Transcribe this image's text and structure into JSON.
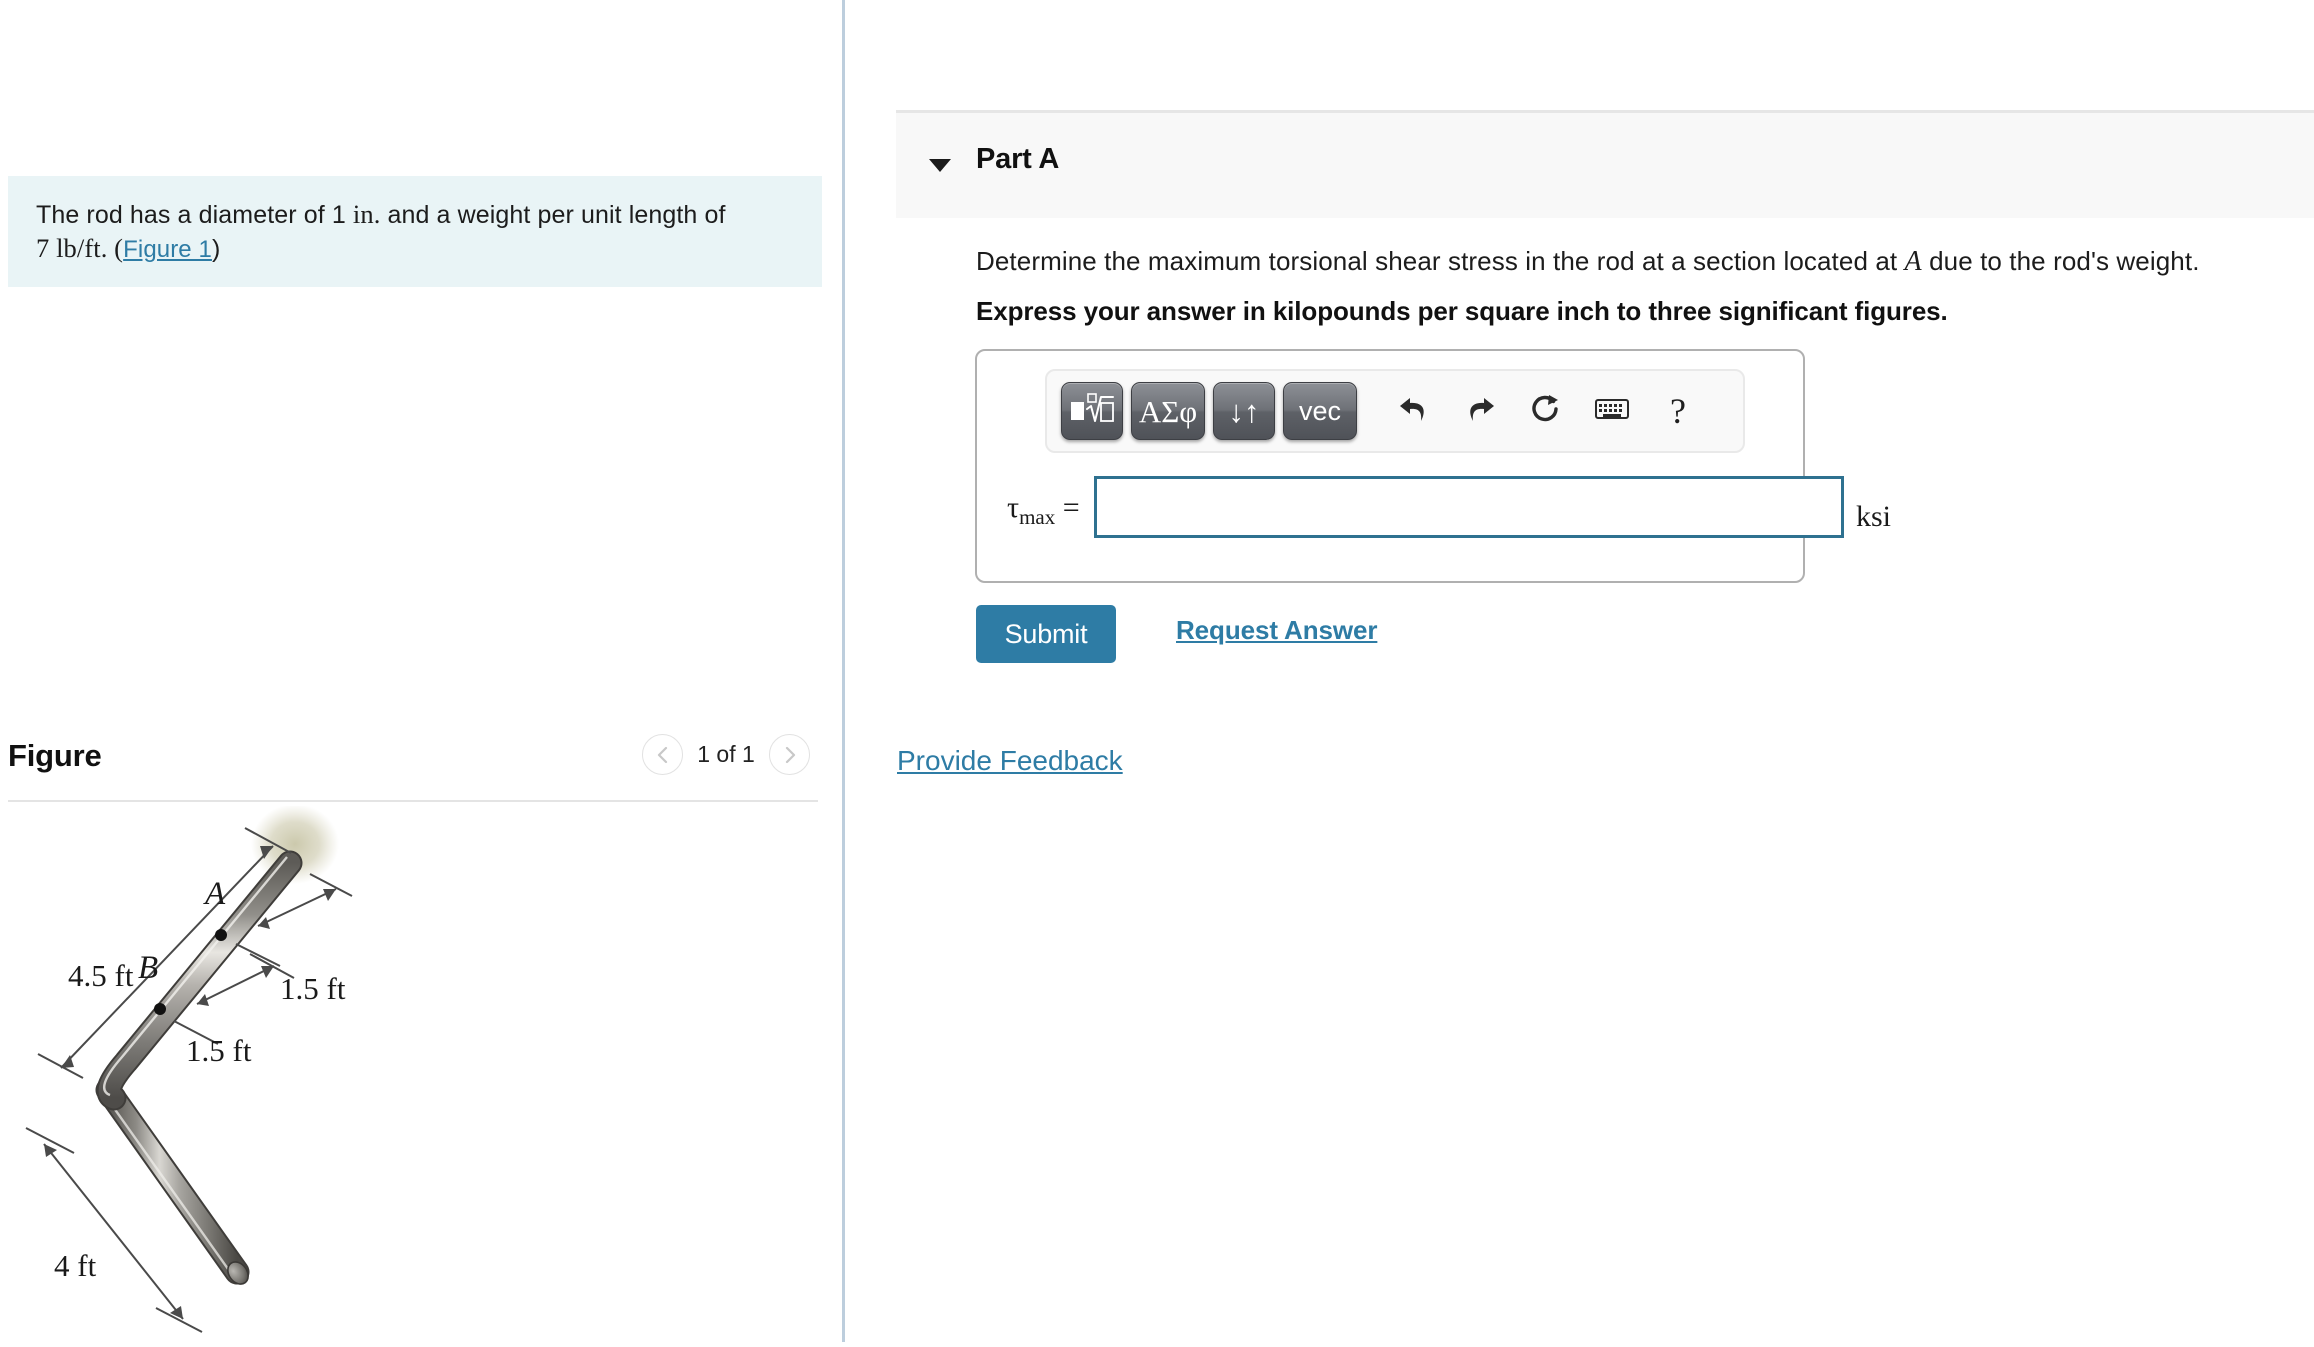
{
  "left_panel": {
    "problem_statement": {
      "line1_pre": "The rod has a diameter of 1 ",
      "line1_unit": "in.",
      "line1_post": " and a weight per unit length of",
      "line2_value": "7 lb/ft. (",
      "figure_link": "Figure 1",
      "line2_close": ")"
    },
    "figure_section": {
      "title": "Figure",
      "page_indicator": "1 of 1",
      "prev_icon": "chevron-left-icon",
      "next_icon": "chevron-right-icon"
    },
    "figure_diagram": {
      "type": "engineering-diagram",
      "description": "L-shaped circular rod fixed at a wall, shown in isometric view",
      "labels": [
        {
          "text": "4.5 ft",
          "kind": "dimension"
        },
        {
          "text": "1.5 ft",
          "kind": "dimension"
        },
        {
          "text": "1.5 ft",
          "kind": "dimension"
        },
        {
          "text": "4 ft",
          "kind": "dimension"
        },
        {
          "text": "A",
          "kind": "point"
        },
        {
          "text": "B",
          "kind": "point"
        }
      ]
    }
  },
  "right_panel": {
    "part_header": {
      "label": "Part A",
      "caret_icon": "triangle-down-icon"
    },
    "question_pre": "Determine the maximum torsional shear stress in the rod at a section located at ",
    "question_var": "A",
    "question_post": " due to the rod's weight.",
    "instruction": "Express your answer in kilopounds per square inch to three significant figures.",
    "math_toolbar": {
      "buttons": [
        {
          "name": "math-template-button",
          "glyph": "template-radical-icon"
        },
        {
          "name": "greek-symbols-button",
          "glyph": "ΑΣφ"
        },
        {
          "name": "arrows-button",
          "glyph": "↓↑"
        },
        {
          "name": "vector-button",
          "glyph": "vec"
        }
      ],
      "icons": [
        {
          "name": "undo-icon"
        },
        {
          "name": "redo-icon"
        },
        {
          "name": "reset-icon"
        },
        {
          "name": "keyboard-icon"
        },
        {
          "name": "help-icon",
          "glyph": "?"
        }
      ]
    },
    "answer": {
      "variable": "τ",
      "subscript": "max",
      "equals": "=",
      "value": "",
      "placeholder": "",
      "unit": "ksi"
    },
    "submit_label": "Submit",
    "request_answer_label": "Request Answer",
    "provide_feedback_label": "Provide Feedback"
  },
  "colors": {
    "accent_blue": "#2e7ca5",
    "input_border": "#2e7190",
    "info_box_bg": "#e9f4f6",
    "panel_bg": "#f8f8f8",
    "divider": "#bdcedd"
  }
}
